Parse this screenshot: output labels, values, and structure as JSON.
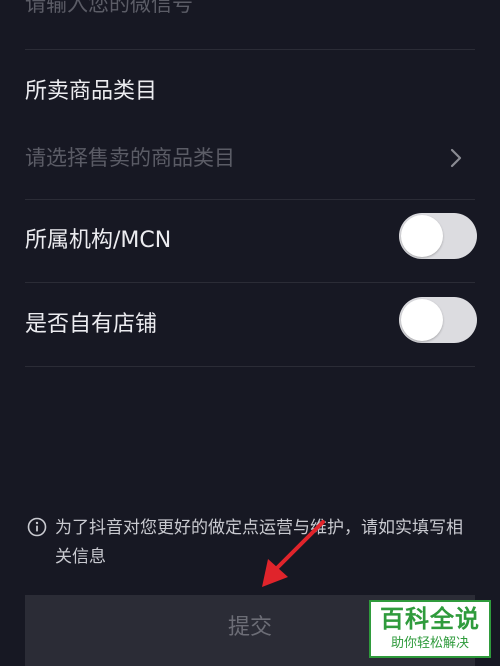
{
  "wechat_field": {
    "placeholder": "请输入您的微信号"
  },
  "category_field": {
    "label": "所卖商品类目",
    "placeholder": "请选择售卖的商品类目",
    "chevron_icon": "chevron-right-icon"
  },
  "mcn_field": {
    "label": "所属机构/MCN",
    "toggle_on": false
  },
  "own_store_field": {
    "label": "是否自有店铺",
    "toggle_on": false
  },
  "notice": {
    "icon": "info-icon",
    "text": "为了抖音对您更好的做定点运营与维护，请如实填写相关信息"
  },
  "submit": {
    "label": "提交"
  },
  "watermark": {
    "main": "百科全说",
    "sub": "助你轻松解决"
  },
  "colors": {
    "background": "#171823",
    "annotation_arrow": "#e0242b",
    "watermark_green": "#2f9b3c"
  }
}
